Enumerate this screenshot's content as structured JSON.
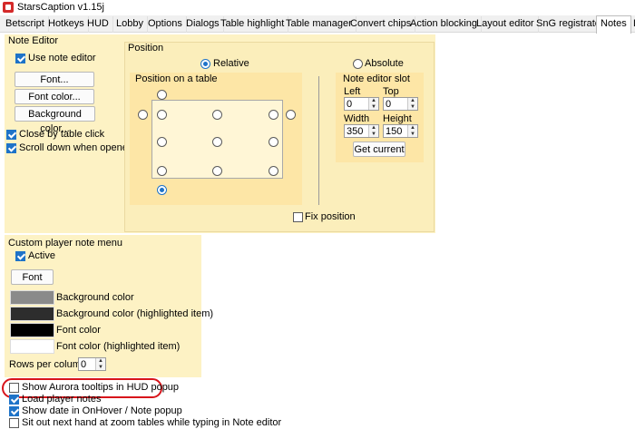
{
  "window": {
    "title": "StarsCaption v1.15j"
  },
  "tabs": [
    "Betscript",
    "Hotkeys",
    "HUD",
    "Lobby",
    "Options",
    "Dialogs",
    "Table highlight",
    "Table manager",
    "Convert chips",
    "Action blocking",
    "Layout editor",
    "SnG registrator",
    "Notes",
    "L"
  ],
  "note_editor": {
    "label": "Note Editor",
    "use_note_editor": "Use note editor",
    "font_button": "Font...",
    "font_color_button": "Font color...",
    "background_color_button": "Background color...",
    "close_by_table_click": "Close by table click",
    "scroll_down_when_opened": "Scroll down when opened"
  },
  "position": {
    "label": "Position",
    "relative": "Relative",
    "absolute": "Absolute",
    "position_on_table": "Position on a table",
    "slot_label": "Note editor slot",
    "left_label": "Left",
    "top_label": "Top",
    "width_label": "Width",
    "height_label": "Height",
    "left_value": "0",
    "top_value": "0",
    "width_value": "350",
    "height_value": "150",
    "get_current": "Get current",
    "fix_position": "Fix position"
  },
  "custom_menu": {
    "label": "Custom player note menu",
    "active": "Active",
    "font_button": "Font",
    "bg_color": "Background color",
    "bg_color_hl": "Background color (highlighted item)",
    "font_color": "Font color",
    "font_color_hl": "Font color (highlighted item)",
    "rows_per_column": "Rows per column",
    "rows_value": "0",
    "colors": {
      "bg": "#8a8a8a",
      "bg_hl": "#2d2d2d",
      "font": "#000000",
      "font_hl": "#ffffff"
    }
  },
  "options": {
    "show_aurora": "Show Aurora tooltips in HUD popup",
    "load_player_notes": "Load player notes",
    "show_date": "Show date in OnHover / Note popup",
    "sit_out": "Sit out next hand at zoom tables while typing in Note editor"
  },
  "icons": {
    "app": "app-icon"
  },
  "accent": "#1e73c8",
  "highlight": "#d8141b"
}
